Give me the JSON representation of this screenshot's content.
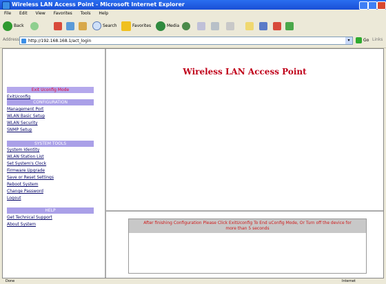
{
  "window": {
    "title": "Wireless LAN Access Point - Microsoft Internet Explorer"
  },
  "menu": [
    "File",
    "Edit",
    "View",
    "Favorites",
    "Tools",
    "Help"
  ],
  "toolbar": {
    "back": "Back",
    "search": "Search",
    "favorites": "Favorites",
    "media": "Media"
  },
  "address": {
    "label": "Address",
    "url": "http://192.168.168.1/act_login",
    "go": "Go",
    "links": "Links"
  },
  "page": {
    "title": "Wireless LAN Access Point"
  },
  "sidebar": {
    "exit_header": "Exit Uconfig Mode",
    "exit_link": "ExitUconfig",
    "config_header": "CONFIGURATION",
    "config_items": [
      "Management Port",
      "WLAN Basic Setup",
      "WLAN Security",
      "SNMP Setup"
    ],
    "tools_header": "SYSTEM TOOLS",
    "tools_items": [
      "System Identity",
      "WLAN Station List",
      "Set System's Clock",
      "Firmware Upgrade",
      "Save or Reset Settings",
      "Reboot System",
      "Change Password",
      "Logout"
    ],
    "help_header": "HELP",
    "help_items": [
      "Get Technical Support",
      "About System"
    ]
  },
  "message": {
    "line1": "After finishing Configuration Please Click ExitUconfig To End uConfig Mode, Or Turn off the device for",
    "line2": "more than 5 seconds"
  },
  "status": {
    "left": "Done",
    "right": "Internet"
  },
  "colors": {
    "title_red": "#c0001a",
    "section_purple": "#aaa0e8",
    "link_blue": "#000066",
    "message_red": "#d01818"
  }
}
